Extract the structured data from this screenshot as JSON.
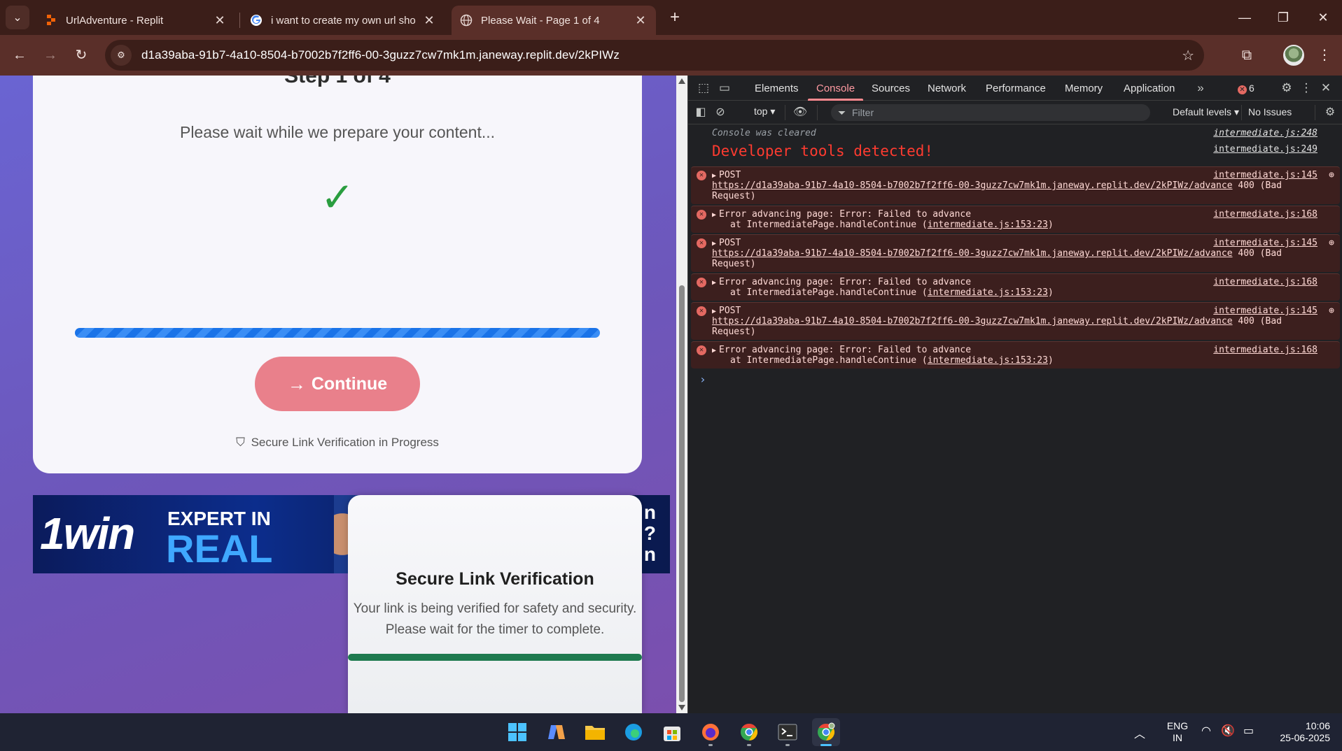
{
  "browser": {
    "tabs": [
      {
        "title": "UrlAdventure - Replit",
        "icon": "replit-icon"
      },
      {
        "title": "i want to create my own url sho",
        "icon": "google-icon"
      },
      {
        "title": "Please Wait - Page 1 of 4",
        "icon": "globe-icon"
      }
    ],
    "url": "d1a39aba-91b7-4a10-8504-b7002b7f2ff6-00-3guzz7cw7mk1m.janeway.replit.dev/2kPIWz"
  },
  "page": {
    "step_title": "Step 1 of 4",
    "wait_message": "Please wait while we prepare your content...",
    "check_glyph": "✓",
    "progress": 1.0,
    "continue_label": "Continue",
    "verification_text": "Secure Link Verification in Progress",
    "ad": {
      "logo": "1win",
      "line1": "EXPERT IN",
      "line2": "REAL",
      "right_text": "n\n?\nn"
    },
    "popup": {
      "title": "Secure Link Verification",
      "description": "Your link is being verified for safety and security. Please wait for the timer to complete.",
      "progress": 1.0
    }
  },
  "devtools": {
    "tabs": [
      "Elements",
      "Console",
      "Sources",
      "Network",
      "Performance",
      "Memory",
      "Application"
    ],
    "active_tab": "Console",
    "error_count": "6",
    "context": "top",
    "filter_placeholder": "Filter",
    "levels": "Default levels",
    "issues": "No Issues",
    "logs": [
      {
        "type": "info",
        "text": "Console was cleared",
        "src": "intermediate.js:248"
      },
      {
        "type": "big",
        "text": "Developer tools detected!",
        "src": "intermediate.js:249"
      },
      {
        "type": "post",
        "method": "POST",
        "src": "intermediate.js:145",
        "url": "https://d1a39aba-91b7-4a10-8504-b7002b7f2ff6-00-3guzz7cw7mk1m.janeway.replit.dev/2kPIWz/advance",
        "status": "400 (Bad",
        "status2": "Request)"
      },
      {
        "type": "error",
        "text": "Error advancing page: Error: Failed to advance",
        "at": "at IntermediatePage.handleContinue (",
        "at_link": "intermediate.js:153:23",
        "src": "intermediate.js:168"
      },
      {
        "type": "post",
        "method": "POST",
        "src": "intermediate.js:145",
        "url": "https://d1a39aba-91b7-4a10-8504-b7002b7f2ff6-00-3guzz7cw7mk1m.janeway.replit.dev/2kPIWz/advance",
        "status": "400 (Bad",
        "status2": "Request)"
      },
      {
        "type": "error",
        "text": "Error advancing page: Error: Failed to advance",
        "at": "at IntermediatePage.handleContinue (",
        "at_link": "intermediate.js:153:23",
        "src": "intermediate.js:168"
      },
      {
        "type": "post",
        "method": "POST",
        "src": "intermediate.js:145",
        "url": "https://d1a39aba-91b7-4a10-8504-b7002b7f2ff6-00-3guzz7cw7mk1m.janeway.replit.dev/2kPIWz/advance",
        "status": "400 (Bad",
        "status2": "Request)"
      },
      {
        "type": "error",
        "text": "Error advancing page: Error: Failed to advance",
        "at": "at IntermediatePage.handleContinue (",
        "at_link": "intermediate.js:153:23",
        "src": "intermediate.js:168"
      }
    ],
    "prompt": "›"
  },
  "taskbar": {
    "apps": [
      "windows-start-icon",
      "copilot-icon",
      "file-explorer-icon",
      "edge-icon",
      "store-icon",
      "firefox-icon",
      "chrome-icon",
      "terminal-icon",
      "chrome-profile-icon"
    ],
    "lang": "ENG",
    "region": "IN",
    "time": "10:06",
    "date": "25-06-2025"
  },
  "colors": {
    "tabstrip": "#3b1e19",
    "toolbar": "#5a2f29",
    "continue": "#e9808b",
    "progress": "#1a73e8",
    "popup_bar": "#1e7a4f",
    "error_bg": "#3c1f1e"
  }
}
